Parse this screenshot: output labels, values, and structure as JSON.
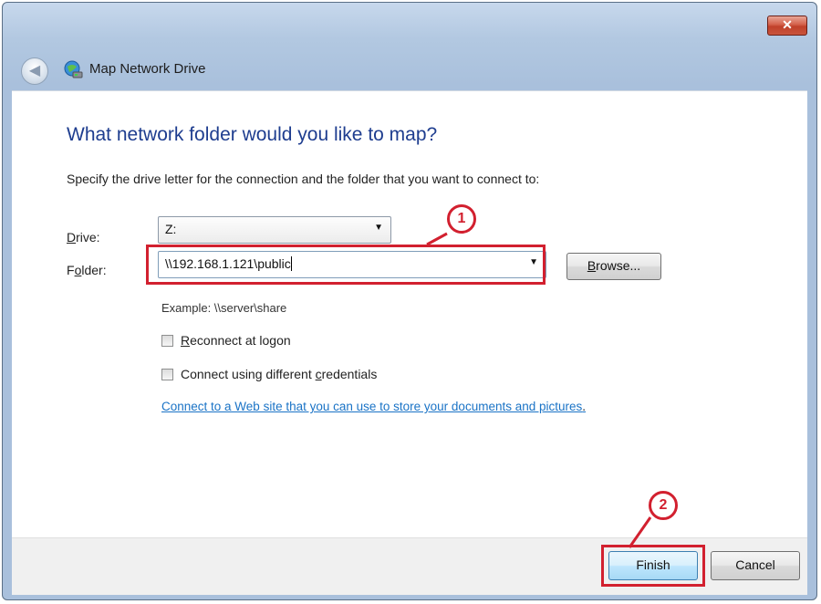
{
  "window": {
    "title": "Map Network Drive",
    "close_glyph": "✕",
    "back_glyph": "◀"
  },
  "wizard": {
    "heading": "What network folder would you like to map?",
    "instruction": "Specify the drive letter for the connection and the folder that you want to connect to:"
  },
  "drive": {
    "label_key": "D",
    "label_rest": "rive:",
    "value": "Z:"
  },
  "folder": {
    "label_pre": "F",
    "label_key": "o",
    "label_rest": "lder:",
    "value": "\\\\192.168.1.121\\public"
  },
  "browse": {
    "label_key": "B",
    "label_rest": "rowse..."
  },
  "example": "Example: \\\\server\\share",
  "reconnect": {
    "label_key": "R",
    "label_rest": "econnect at logon",
    "checked": false
  },
  "credentials": {
    "label_pre": "Connect using different ",
    "label_key": "c",
    "label_rest": "redentials",
    "checked": false
  },
  "web_link": "Connect to a Web site that you can use to store your documents and pictures",
  "web_link_suffix": ".",
  "footer": {
    "finish": "Finish",
    "cancel": "Cancel"
  },
  "callouts": {
    "one": "1",
    "two": "2"
  },
  "colors": {
    "annotation": "#d2202f",
    "heading": "#1e3d8f",
    "link": "#1a73c6"
  },
  "icons": {
    "arrow": "▼"
  }
}
